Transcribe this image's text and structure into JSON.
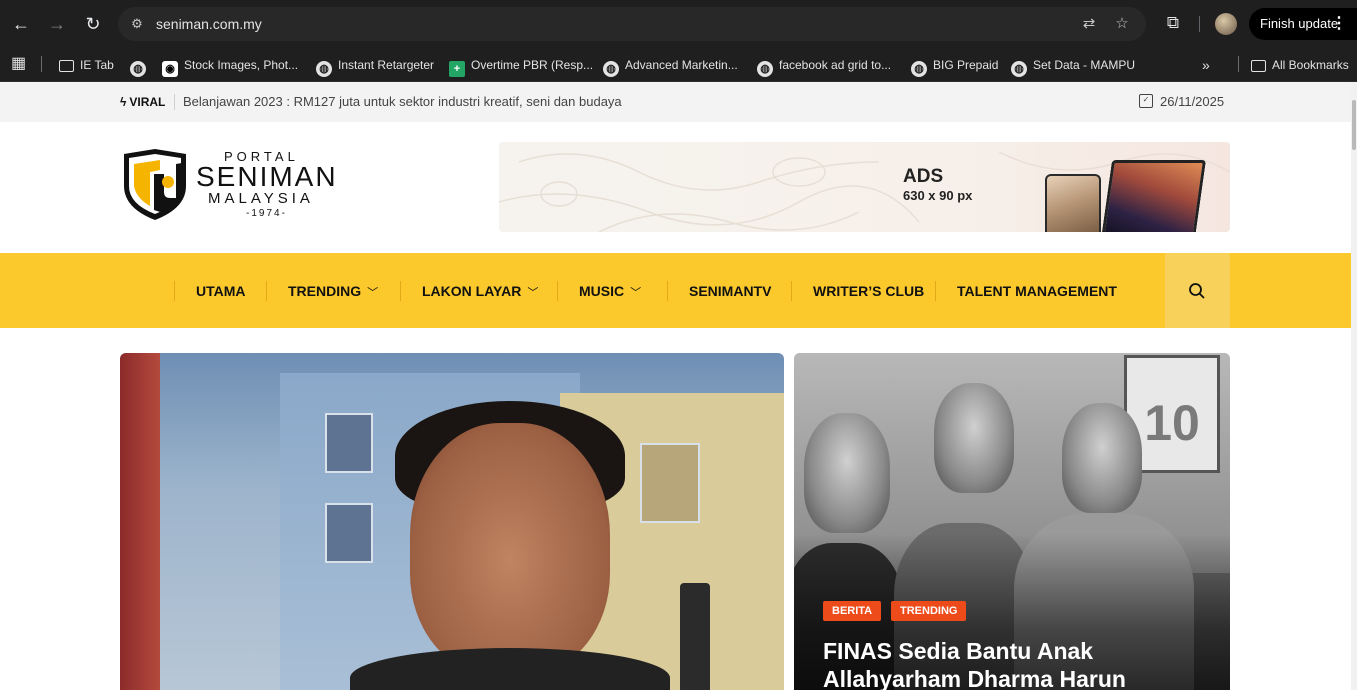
{
  "browser": {
    "url": "seniman.com.my",
    "finish_update_label": "Finish update",
    "bookmarks": [
      {
        "label": "IE Tab",
        "icon": "folder-icon"
      },
      {
        "label": "",
        "icon": "globe-icon"
      },
      {
        "label": "Stock Images, Phot...",
        "icon": "stock-icon"
      },
      {
        "label": "Instant Retargeter",
        "icon": "globe-icon"
      },
      {
        "label": "Overtime PBR (Resp...",
        "icon": "sheets-icon"
      },
      {
        "label": "Advanced Marketin...",
        "icon": "globe-icon"
      },
      {
        "label": "facebook ad grid to...",
        "icon": "globe-icon"
      },
      {
        "label": "BIG Prepaid",
        "icon": "globe-icon"
      },
      {
        "label": "Set Data - MAMPU",
        "icon": "globe-icon"
      }
    ],
    "all_bookmarks_label": "All Bookmarks"
  },
  "site": {
    "topbar": {
      "viral_label": "VIRAL",
      "ticker": "Belanjawan 2023 : RM127 juta untuk sektor industri kreatif, seni dan budaya",
      "date": "26/11/2025"
    },
    "logo": {
      "portal": "PORTAL",
      "seniman": "SENIMAN",
      "malaysia": "MALAYSIA",
      "year": "-1974-"
    },
    "ad": {
      "title": "ADS",
      "size": "630 x 90 px"
    },
    "nav": [
      {
        "label": "UTAMA",
        "dropdown": false
      },
      {
        "label": "TRENDING",
        "dropdown": true
      },
      {
        "label": "LAKON LAYAR",
        "dropdown": true
      },
      {
        "label": "MUSIC",
        "dropdown": true
      },
      {
        "label": "SENIMANTV",
        "dropdown": false
      },
      {
        "label": "WRITER’S CLUB",
        "dropdown": false
      },
      {
        "label": "TALENT MANAGEMENT",
        "dropdown": false
      }
    ],
    "featured_right": {
      "badges": [
        "BERITA",
        "TRENDING"
      ],
      "title": "FINAS Sedia Bantu Anak Allahyarham Dharma Harun"
    },
    "colors": {
      "nav_bg": "#fcc92d",
      "badge": "#ee4b1b",
      "chrome": "#1f1f1f"
    }
  }
}
